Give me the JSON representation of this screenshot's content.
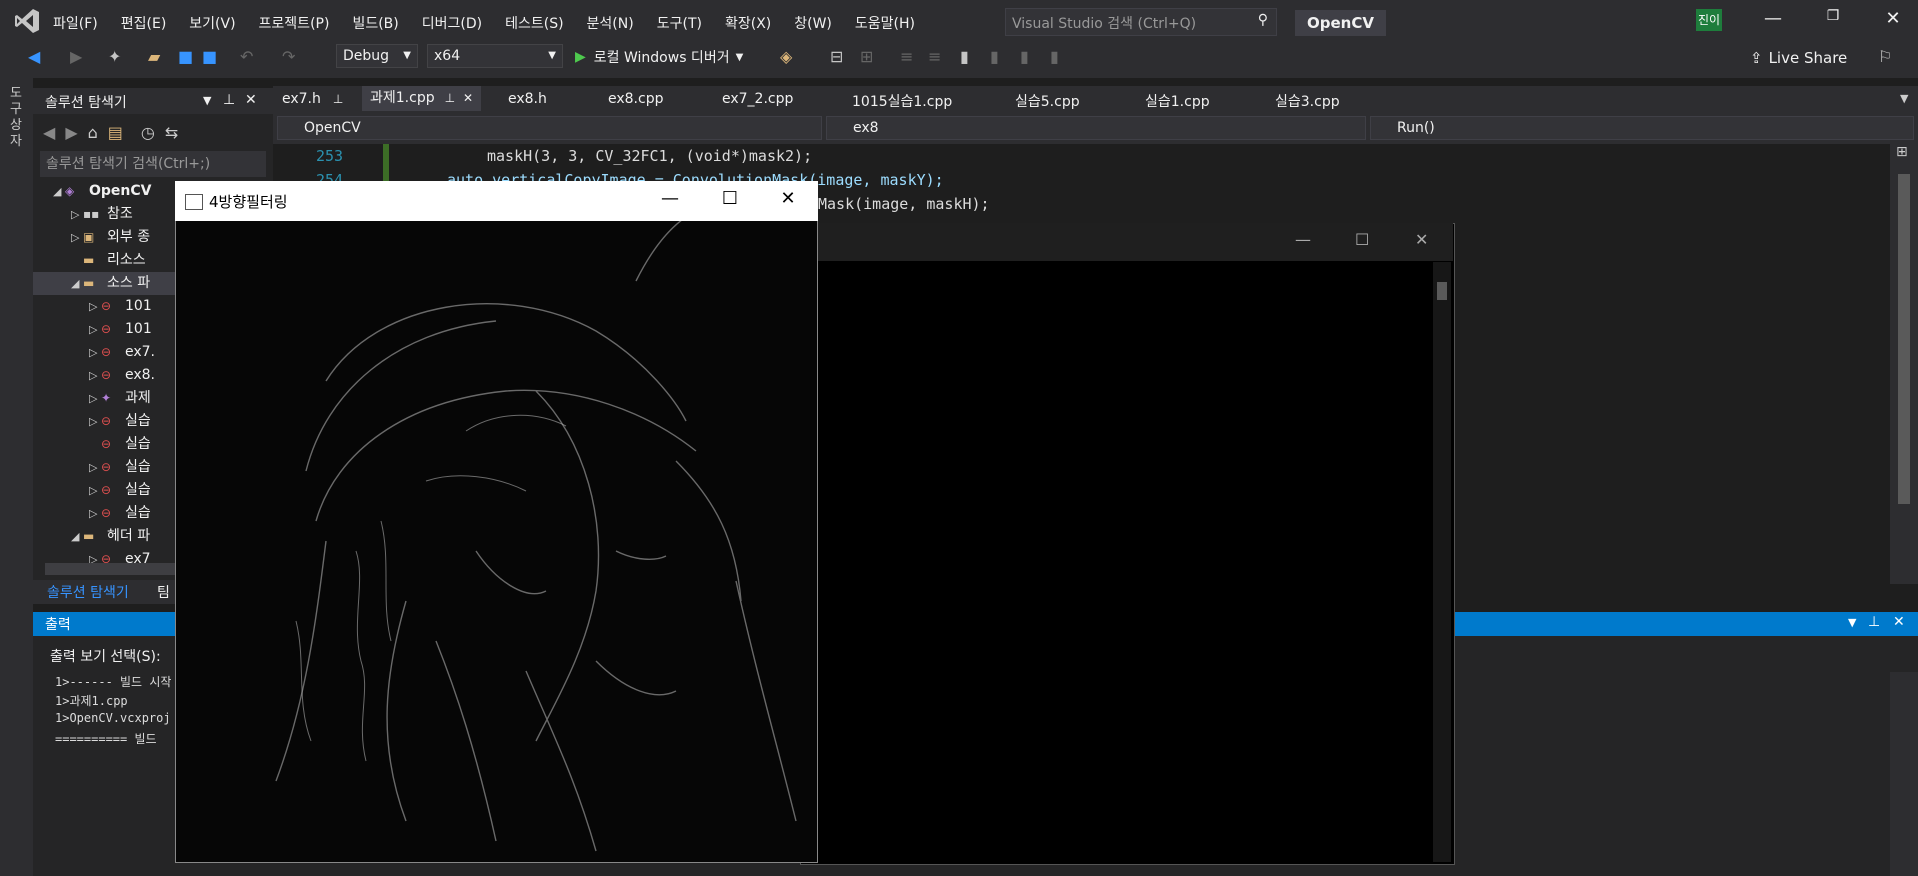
{
  "menubar": {
    "items": [
      "파일(F)",
      "편집(E)",
      "보기(V)",
      "프로젝트(P)",
      "빌드(B)",
      "디버그(D)",
      "테스트(S)",
      "분석(N)",
      "도구(T)",
      "확장(X)",
      "창(W)",
      "도움말(H)"
    ],
    "search_placeholder": "Visual Studio 검색 (Ctrl+Q)",
    "project_title": "OpenCV",
    "user_initials": "진이"
  },
  "toolbar": {
    "config": "Debug",
    "platform": "x64",
    "debugger": "로컬 Windows 디버거",
    "live_share": "Live Share"
  },
  "left_strip": {
    "label": "도구 상자"
  },
  "solution_explorer": {
    "title": "솔루션 탐색기",
    "search_placeholder": "솔루션 탐색기 검색(Ctrl+;)",
    "items": [
      {
        "label": "OpenCV",
        "bold": true
      },
      {
        "label": "참조"
      },
      {
        "label": "외부 종"
      },
      {
        "label": "리소스"
      },
      {
        "label": "소스 파"
      },
      {
        "label": "101"
      },
      {
        "label": "101"
      },
      {
        "label": "ex7."
      },
      {
        "label": "ex8."
      },
      {
        "label": "과제"
      },
      {
        "label": "실습"
      },
      {
        "label": "실습"
      },
      {
        "label": "실습"
      },
      {
        "label": "실습"
      },
      {
        "label": "실습"
      },
      {
        "label": "헤더 파"
      },
      {
        "label": "ex7"
      }
    ],
    "tab_active": "솔루션 탐색기",
    "tab_other": "팀"
  },
  "doc_tabs": [
    "ex7.h",
    "과제1.cpp",
    "ex8.h",
    "ex8.cpp",
    "ex7_2.cpp",
    "1015실습1.cpp",
    "실습5.cpp",
    "실습1.cpp",
    "실습3.cpp"
  ],
  "nav": {
    "project": "OpenCV",
    "scope": "ex8",
    "member": "Run()"
  },
  "code": {
    "line1_num": "253",
    "line1": "maskH(3, 3, CV_32FC1, (void*)mask2);",
    "line2_num": "254",
    "line2": "auto verticalCopyImage = ConvolutionMask(image, maskY);",
    "line3": "Mask(image, maskH);"
  },
  "output": {
    "title": "출력",
    "select_label": "출력 보기 선택(S):",
    "lines": [
      "1>------ 빌드 시작",
      "1>과제1.cpp",
      "1>OpenCV.vcxproj",
      "========== 빌드"
    ]
  },
  "image_window": {
    "title": "4방향필터링"
  }
}
